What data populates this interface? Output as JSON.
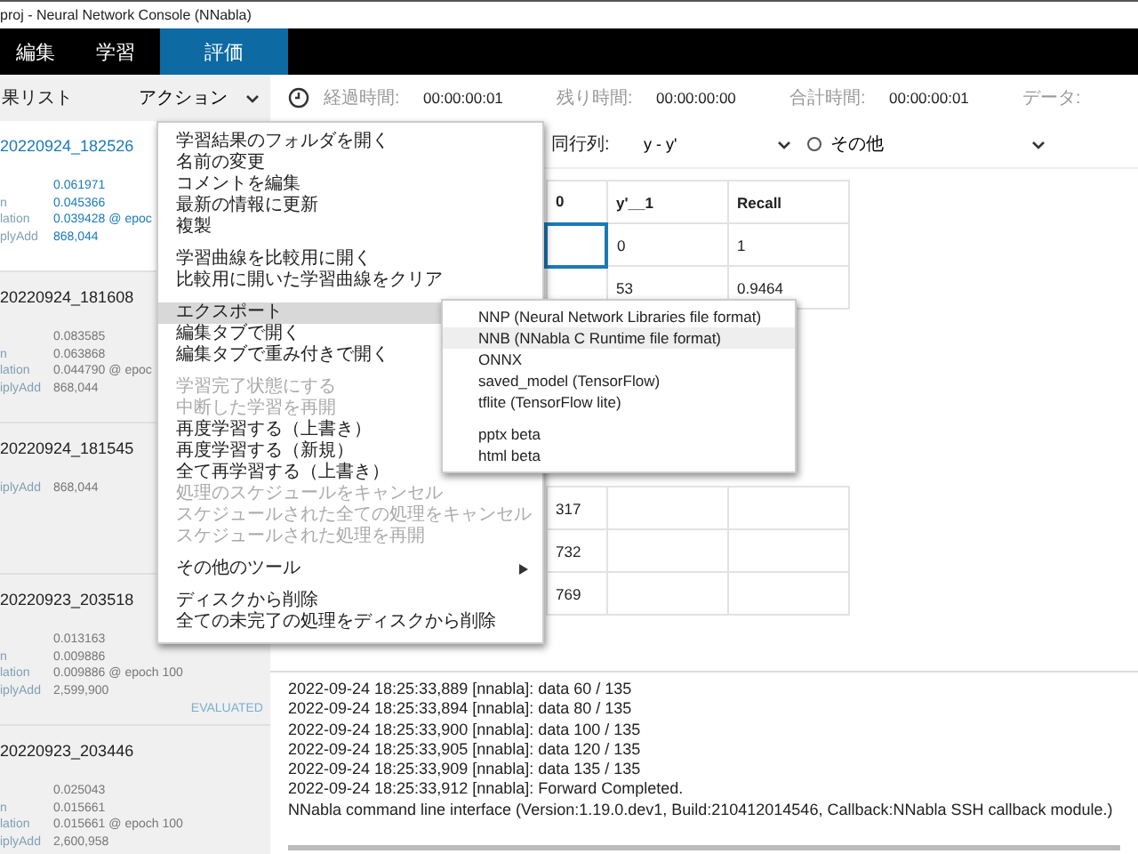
{
  "window": {
    "title": "proj - Neural Network Console (NNabla)"
  },
  "tabs": [
    {
      "label": "編集",
      "selected": false
    },
    {
      "label": "学習",
      "selected": false
    },
    {
      "label": "評価",
      "selected": true
    }
  ],
  "toolbar": {
    "list_label": "果リスト",
    "action_button": "アクション",
    "timers": [
      {
        "label": "経過時間:",
        "value": "00:00:00:01"
      },
      {
        "label": "残り時間:",
        "value": "00:00:00:00"
      },
      {
        "label": "合計時間:",
        "value": "00:00:00:01"
      },
      {
        "label": "データ:"
      }
    ]
  },
  "results": [
    {
      "title": "20220924_182526",
      "selected": true,
      "rows": [
        {
          "value": "0.061971"
        },
        {
          "label": "n",
          "value": "0.045366"
        },
        {
          "label": "lation",
          "value": "0.039428 @ epoc"
        },
        {
          "label": "plyAdd",
          "value": "868,044"
        }
      ]
    },
    {
      "title": "20220924_181608",
      "selected": false,
      "rows": [
        {
          "value": "0.083585"
        },
        {
          "label": "n",
          "value": "0.063868"
        },
        {
          "label": "lation",
          "value": "0.044790 @ epoc"
        },
        {
          "label": "iplyAdd",
          "value": "868,044"
        }
      ]
    },
    {
      "title": "20220924_181545",
      "selected": false,
      "rows": [
        {
          "label": "iplyAdd",
          "value": "868,044"
        }
      ]
    },
    {
      "title": "20220923_203518",
      "selected": false,
      "rows": [
        {
          "value": "0.013163"
        },
        {
          "label": "n",
          "value": "0.009886"
        },
        {
          "label": "lation",
          "value": "0.009886 @ epoch 100"
        },
        {
          "label": "iplyAdd",
          "value": "2,599,900"
        }
      ],
      "status": "EVALUATED"
    },
    {
      "title": "20220923_203446",
      "selected": false,
      "rows": [
        {
          "value": "0.025043"
        },
        {
          "label": "n",
          "value": "0.015661"
        },
        {
          "label": "lation",
          "value": "0.015661 @ epoch 100"
        },
        {
          "label": "iplyAdd",
          "value": "2,600,958"
        }
      ]
    }
  ],
  "eval_options": {
    "matrix_label": "同行列:",
    "matrix_select": "y - y'",
    "other_radio": {
      "label": "その他",
      "selected": false
    }
  },
  "table": {
    "columns": [
      "0",
      "y'__1",
      "Recall"
    ],
    "rows": [
      {
        "cells": [
          "",
          "0",
          "1"
        ],
        "selected": true
      },
      {
        "cells": [
          "",
          "53",
          "0.9464"
        ],
        "selected": false
      },
      {
        "cells": [
          "317",
          "",
          ""
        ],
        "selected": false
      },
      {
        "cells": [
          "732",
          "",
          ""
        ],
        "selected": false
      },
      {
        "cells": [
          "769",
          "",
          ""
        ],
        "selected": false
      }
    ]
  },
  "log": [
    "2022-09-24 18:25:33,889 [nnabla]: data 60 / 135",
    "2022-09-24 18:25:33,894 [nnabla]: data 80 / 135",
    "2022-09-24 18:25:33,900 [nnabla]: data 100 / 135",
    "2022-09-24 18:25:33,905 [nnabla]: data 120 / 135",
    "2022-09-24 18:25:33,909 [nnabla]: data 135 / 135",
    "2022-09-24 18:25:33,912 [nnabla]: Forward Completed.",
    "NNabla command line interface (Version:1.19.0.dev1, Build:210412014546, Callback:NNabla SSH callback module.)"
  ],
  "context_menu": [
    {
      "kind": "item",
      "label": "学習結果のフォルダを開く",
      "selected": false
    },
    {
      "kind": "item",
      "label": "名前の変更",
      "selected": false
    },
    {
      "kind": "item",
      "label": "コメントを編集",
      "selected": false
    },
    {
      "kind": "item",
      "label": "最新の情報に更新",
      "selected": false
    },
    {
      "kind": "item",
      "label": "複製",
      "selected": false
    },
    {
      "kind": "separator"
    },
    {
      "kind": "item",
      "label": "学習曲線を比較用に開く",
      "selected": false
    },
    {
      "kind": "item",
      "label": "比較用に開いた学習曲線をクリア",
      "selected": false
    },
    {
      "kind": "separator"
    },
    {
      "kind": "item",
      "label": "エクスポート",
      "selected": true
    },
    {
      "kind": "item",
      "label": "編集タブで開く",
      "selected": false
    },
    {
      "kind": "item",
      "label": "編集タブで重み付きで開く",
      "selected": false
    },
    {
      "kind": "separator"
    },
    {
      "kind": "disabled",
      "label": "学習完了状態にする",
      "selected": false
    },
    {
      "kind": "disabled",
      "label": "中断した学習を再開",
      "selected": false
    },
    {
      "kind": "item",
      "label": "再度学習する（上書き）",
      "selected": false
    },
    {
      "kind": "item",
      "label": "再度学習する（新規）",
      "selected": false
    },
    {
      "kind": "item",
      "label": "全て再学習する（上書き）",
      "selected": false
    },
    {
      "kind": "disabled",
      "label": "処理のスケジュールをキャンセル",
      "selected": false
    },
    {
      "kind": "disabled",
      "label": "スケジュールされた全ての処理をキャンセル",
      "selected": false
    },
    {
      "kind": "disabled",
      "label": "スケジュールされた処理を再開",
      "selected": false
    },
    {
      "kind": "separator"
    },
    {
      "kind": "submenu",
      "label": "その他のツール",
      "selected": false
    },
    {
      "kind": "separator"
    },
    {
      "kind": "item",
      "label": "ディスクから削除",
      "selected": false
    },
    {
      "kind": "item",
      "label": "全ての未完了の処理をディスクから削除",
      "selected": false
    }
  ],
  "export_submenu": [
    {
      "kind": "item",
      "label": "NNP (Neural Network Libraries file format)",
      "selected": false
    },
    {
      "kind": "item",
      "label": "NNB (NNabla C Runtime file format)",
      "selected": true
    },
    {
      "kind": "item",
      "label": "ONNX",
      "selected": false
    },
    {
      "kind": "item",
      "label": "saved_model (TensorFlow)",
      "selected": false
    },
    {
      "kind": "item",
      "label": "tflite (TensorFlow lite)",
      "selected": false
    },
    {
      "kind": "separator"
    },
    {
      "kind": "item",
      "label": "pptx beta",
      "selected": false
    },
    {
      "kind": "item",
      "label": "html beta",
      "selected": false
    }
  ]
}
